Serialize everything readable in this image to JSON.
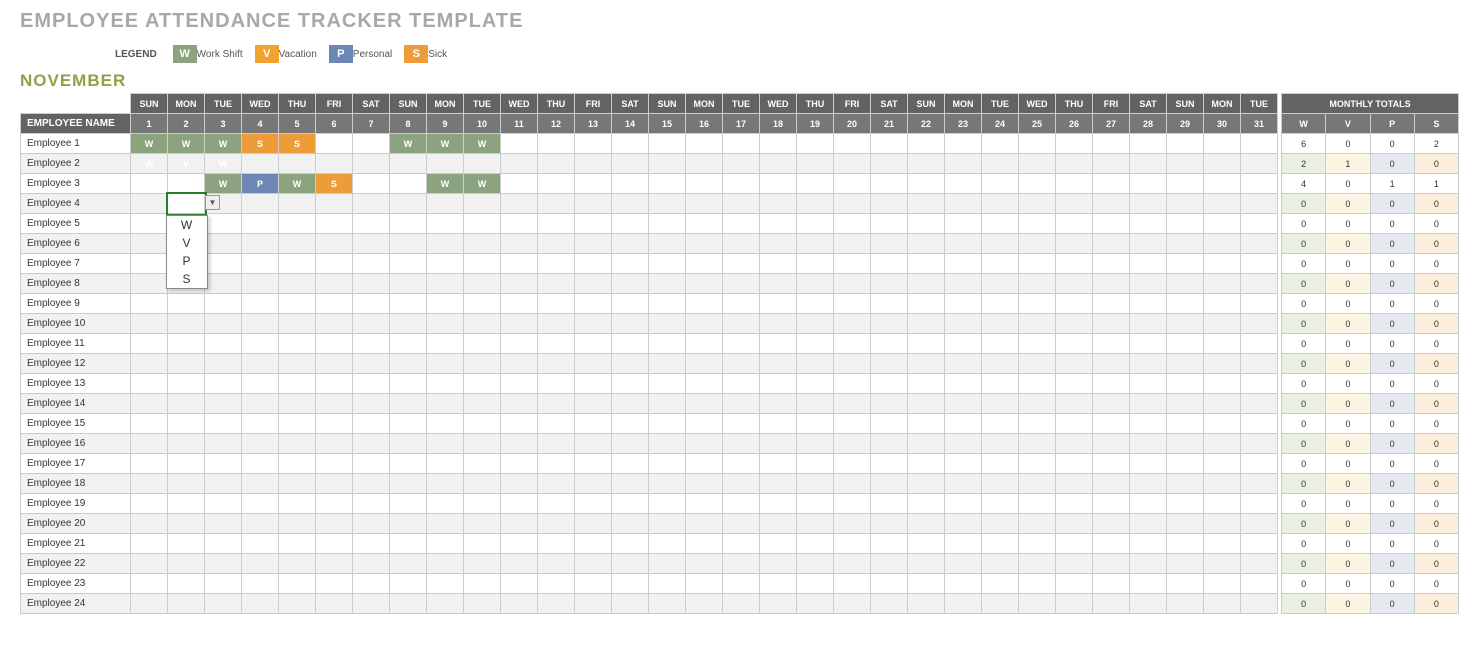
{
  "title": "EMPLOYEE ATTENDANCE TRACKER TEMPLATE",
  "month": "NOVEMBER",
  "legend": {
    "label": "LEGEND",
    "items": [
      {
        "code": "W",
        "text": "Work Shift"
      },
      {
        "code": "V",
        "text": "Vacation"
      },
      {
        "code": "P",
        "text": "Personal"
      },
      {
        "code": "S",
        "text": "Sick"
      }
    ]
  },
  "columns": {
    "name_header": "EMPLOYEE NAME",
    "totals_header": "MONTHLY TOTALS",
    "dows": [
      "SUN",
      "MON",
      "TUE",
      "WED",
      "THU",
      "FRI",
      "SAT",
      "SUN",
      "MON",
      "TUE",
      "WED",
      "THU",
      "FRI",
      "SAT",
      "SUN",
      "MON",
      "TUE",
      "WED",
      "THU",
      "FRI",
      "SAT",
      "SUN",
      "MON",
      "TUE",
      "WED",
      "THU",
      "FRI",
      "SAT",
      "SUN",
      "MON",
      "TUE"
    ],
    "days": [
      "1",
      "2",
      "3",
      "4",
      "5",
      "6",
      "7",
      "8",
      "9",
      "10",
      "11",
      "12",
      "13",
      "14",
      "15",
      "16",
      "17",
      "18",
      "19",
      "20",
      "21",
      "22",
      "23",
      "24",
      "25",
      "26",
      "27",
      "28",
      "29",
      "30",
      "31"
    ],
    "total_cols": [
      "W",
      "V",
      "P",
      "S"
    ]
  },
  "rows": [
    {
      "name": "Employee 1",
      "marks": {
        "1": "W",
        "2": "W",
        "3": "W",
        "4": "S",
        "5": "S",
        "8": "W",
        "9": "W",
        "10": "W"
      },
      "totals": {
        "W": 6,
        "V": 0,
        "P": 0,
        "S": 2
      }
    },
    {
      "name": "Employee 2",
      "marks": {
        "1": "W",
        "2": "V",
        "3": "W"
      },
      "totals": {
        "W": 2,
        "V": 1,
        "P": 0,
        "S": 0
      }
    },
    {
      "name": "Employee 3",
      "marks": {
        "3": "W",
        "4": "P",
        "5": "W",
        "6": "S",
        "9": "W",
        "10": "W"
      },
      "totals": {
        "W": 4,
        "V": 0,
        "P": 1,
        "S": 1
      }
    },
    {
      "name": "Employee 4",
      "marks": {},
      "totals": {
        "W": 0,
        "V": 0,
        "P": 0,
        "S": 0
      },
      "active_day": "2"
    },
    {
      "name": "Employee 5",
      "marks": {},
      "totals": {
        "W": 0,
        "V": 0,
        "P": 0,
        "S": 0
      }
    },
    {
      "name": "Employee 6",
      "marks": {},
      "totals": {
        "W": 0,
        "V": 0,
        "P": 0,
        "S": 0
      }
    },
    {
      "name": "Employee 7",
      "marks": {},
      "totals": {
        "W": 0,
        "V": 0,
        "P": 0,
        "S": 0
      }
    },
    {
      "name": "Employee 8",
      "marks": {},
      "totals": {
        "W": 0,
        "V": 0,
        "P": 0,
        "S": 0
      }
    },
    {
      "name": "Employee 9",
      "marks": {},
      "totals": {
        "W": 0,
        "V": 0,
        "P": 0,
        "S": 0
      }
    },
    {
      "name": "Employee 10",
      "marks": {},
      "totals": {
        "W": 0,
        "V": 0,
        "P": 0,
        "S": 0
      }
    },
    {
      "name": "Employee 11",
      "marks": {},
      "totals": {
        "W": 0,
        "V": 0,
        "P": 0,
        "S": 0
      }
    },
    {
      "name": "Employee 12",
      "marks": {},
      "totals": {
        "W": 0,
        "V": 0,
        "P": 0,
        "S": 0
      }
    },
    {
      "name": "Employee 13",
      "marks": {},
      "totals": {
        "W": 0,
        "V": 0,
        "P": 0,
        "S": 0
      }
    },
    {
      "name": "Employee 14",
      "marks": {},
      "totals": {
        "W": 0,
        "V": 0,
        "P": 0,
        "S": 0
      }
    },
    {
      "name": "Employee 15",
      "marks": {},
      "totals": {
        "W": 0,
        "V": 0,
        "P": 0,
        "S": 0
      }
    },
    {
      "name": "Employee 16",
      "marks": {},
      "totals": {
        "W": 0,
        "V": 0,
        "P": 0,
        "S": 0
      }
    },
    {
      "name": "Employee 17",
      "marks": {},
      "totals": {
        "W": 0,
        "V": 0,
        "P": 0,
        "S": 0
      }
    },
    {
      "name": "Employee 18",
      "marks": {},
      "totals": {
        "W": 0,
        "V": 0,
        "P": 0,
        "S": 0
      }
    },
    {
      "name": "Employee 19",
      "marks": {},
      "totals": {
        "W": 0,
        "V": 0,
        "P": 0,
        "S": 0
      }
    },
    {
      "name": "Employee 20",
      "marks": {},
      "totals": {
        "W": 0,
        "V": 0,
        "P": 0,
        "S": 0
      }
    },
    {
      "name": "Employee 21",
      "marks": {},
      "totals": {
        "W": 0,
        "V": 0,
        "P": 0,
        "S": 0
      }
    },
    {
      "name": "Employee 22",
      "marks": {},
      "totals": {
        "W": 0,
        "V": 0,
        "P": 0,
        "S": 0
      }
    },
    {
      "name": "Employee 23",
      "marks": {},
      "totals": {
        "W": 0,
        "V": 0,
        "P": 0,
        "S": 0
      }
    },
    {
      "name": "Employee 24",
      "marks": {},
      "totals": {
        "W": 0,
        "V": 0,
        "P": 0,
        "S": 0
      }
    }
  ],
  "dropdown": {
    "open": true,
    "options": [
      "W",
      "V",
      "P",
      "S"
    ]
  }
}
